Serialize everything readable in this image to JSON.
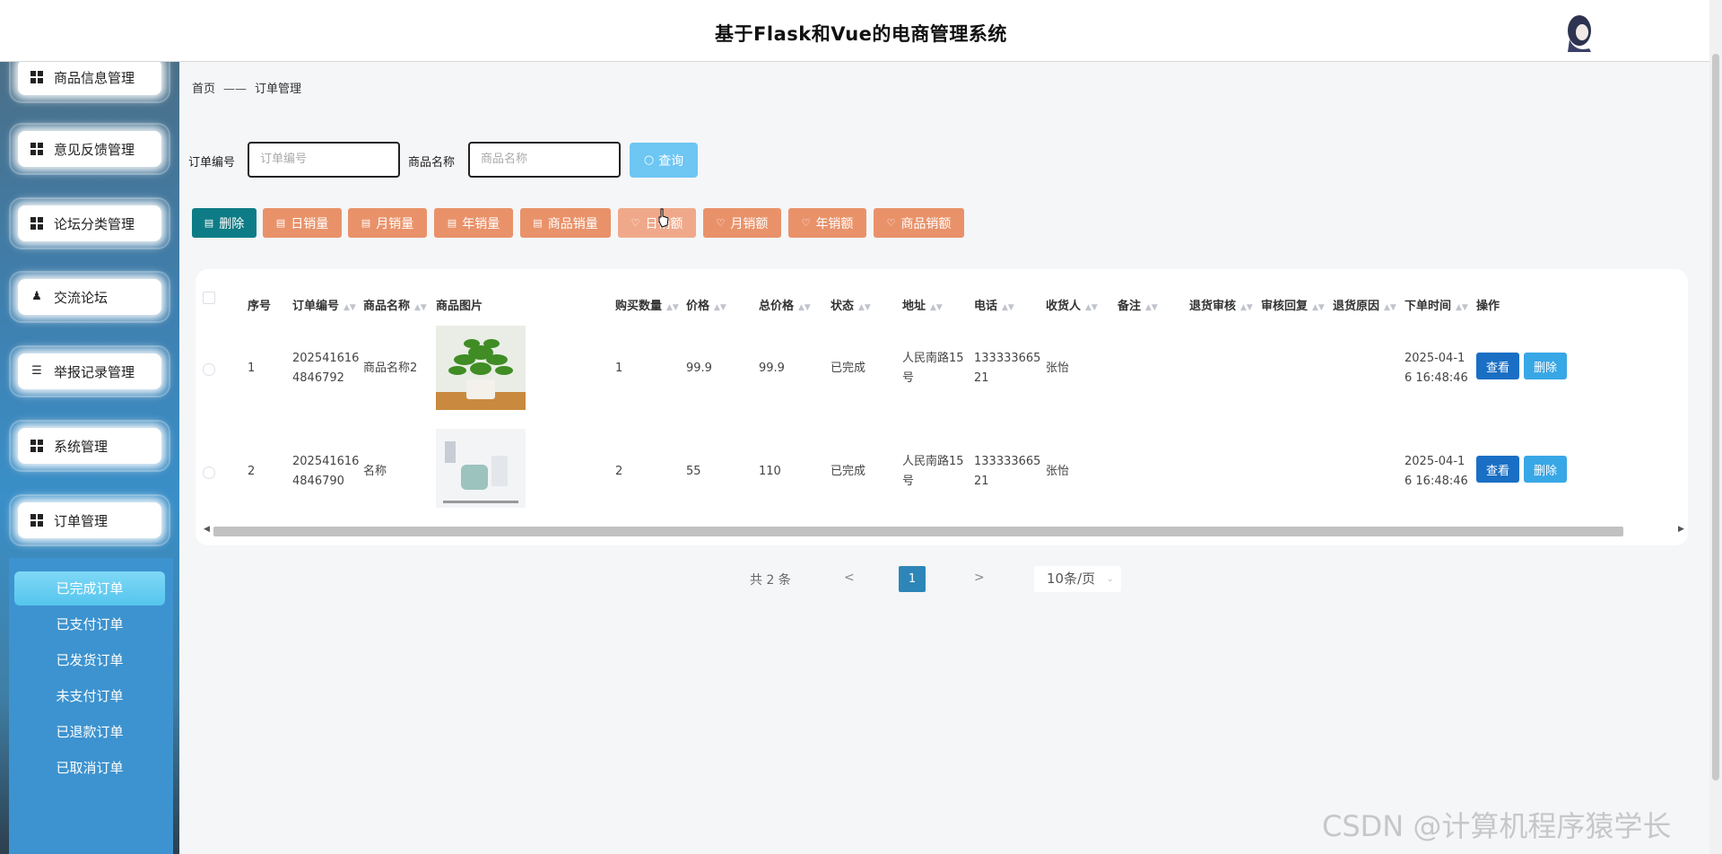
{
  "header": {
    "title": "基于Flask和Vue的电商管理系统"
  },
  "sidebar": {
    "menu": [
      {
        "label": "商品信息管理",
        "icon": "grid-icon"
      },
      {
        "label": "意见反馈管理",
        "icon": "grid-icon"
      },
      {
        "label": "论坛分类管理",
        "icon": "grid-icon"
      },
      {
        "label": "交流论坛",
        "icon": "user-icon"
      },
      {
        "label": "举报记录管理",
        "icon": "list-icon"
      },
      {
        "label": "系统管理",
        "icon": "grid-icon"
      },
      {
        "label": "订单管理",
        "icon": "grid-icon"
      }
    ],
    "submenu": [
      "已完成订单",
      "已支付订单",
      "已发货订单",
      "未支付订单",
      "已退款订单",
      "已取消订单"
    ]
  },
  "breadcrumb": {
    "home": "首页",
    "separator": "——",
    "current": "订单管理"
  },
  "search": {
    "order_no_label": "订单编号",
    "order_no_placeholder": "订单编号",
    "goods_name_label": "商品名称",
    "goods_name_placeholder": "商品名称",
    "query_label": "查询"
  },
  "actions": [
    {
      "label": "删除",
      "icon": "trash-icon"
    },
    {
      "label": "日销量",
      "icon": "chart-icon"
    },
    {
      "label": "月销量",
      "icon": "chart-icon"
    },
    {
      "label": "年销量",
      "icon": "chart-icon"
    },
    {
      "label": "商品销量",
      "icon": "chart-icon"
    },
    {
      "label": "日销额",
      "icon": "heart-icon"
    },
    {
      "label": "月销额",
      "icon": "heart-icon"
    },
    {
      "label": "年销额",
      "icon": "heart-icon"
    },
    {
      "label": "商品销额",
      "icon": "heart-icon"
    }
  ],
  "table": {
    "columns": [
      "序号",
      "订单编号",
      "商品名称",
      "商品图片",
      "购买数量",
      "价格",
      "总价格",
      "状态",
      "地址",
      "电话",
      "收货人",
      "备注",
      "退货审核",
      "审核回复",
      "退货原因",
      "下单时间",
      "操作"
    ],
    "rows": [
      {
        "index": "1",
        "order_no_1": "202541616",
        "order_no_2": "4846792",
        "goods_name": "商品名称2",
        "qty": "1",
        "price": "99.9",
        "total": "99.9",
        "status": "已完成",
        "addr_1": "人民南路15",
        "addr_2": "号",
        "phone_1": "133333665",
        "phone_2": "21",
        "receiver": "张怡",
        "time_1": "2025-04-1",
        "time_2": "6 16:48:46",
        "view": "查看",
        "delete": "删除"
      },
      {
        "index": "2",
        "order_no_1": "202541616",
        "order_no_2": "4846790",
        "goods_name": "名称",
        "qty": "2",
        "price": "55",
        "total": "110",
        "status": "已完成",
        "addr_1": "人民南路15",
        "addr_2": "号",
        "phone_1": "133333665",
        "phone_2": "21",
        "receiver": "张怡",
        "time_1": "2025-04-1",
        "time_2": "6 16:48:46",
        "view": "查看",
        "delete": "删除"
      }
    ]
  },
  "pagination": {
    "total": "共 2 条",
    "prev": "<",
    "page": "1",
    "next": ">",
    "size": "10条/页"
  },
  "watermark": "CSDN @计算机程序猿学长",
  "colors": {
    "sidebar": "#3d93cf",
    "delete_btn": "#0e7c86",
    "stat_btn": "#e9926a",
    "query_btn": "#6ec6f2",
    "view_btn": "#1a6fc4",
    "row_delete_btn": "#38a7e6"
  }
}
